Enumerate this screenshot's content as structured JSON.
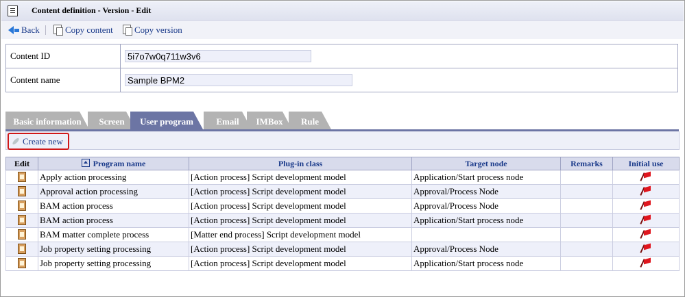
{
  "window": {
    "title": "Content definition - Version - Edit"
  },
  "toolbar": {
    "back_label": "Back",
    "copy_content_label": "Copy content",
    "copy_version_label": "Copy version"
  },
  "content": {
    "id_label": "Content ID",
    "id_value": "5i7o7w0q711w3v6",
    "name_label": "Content name",
    "name_value": "Sample BPM2"
  },
  "tabs": [
    {
      "label": "Basic information",
      "active": false
    },
    {
      "label": "Screen",
      "active": false
    },
    {
      "label": "User program",
      "active": true
    },
    {
      "label": "Email",
      "active": false
    },
    {
      "label": "IMBox",
      "active": false
    },
    {
      "label": "Rule",
      "active": false
    }
  ],
  "actions": {
    "create_new_label": "Create new",
    "highlight_color": "#d01818"
  },
  "table": {
    "headers": {
      "edit": "Edit",
      "program_name": "Program name",
      "plugin_class": "Plug-in class",
      "target_node": "Target node",
      "remarks": "Remarks",
      "initial_use": "Initial use"
    },
    "rows": [
      {
        "program_name": "Apply action processing",
        "plugin_class": "[Action process] Script development model",
        "target_node": "Application/Start process node",
        "remarks": ""
      },
      {
        "program_name": "Approval action processing",
        "plugin_class": "[Action process] Script development model",
        "target_node": "Approval/Process Node",
        "remarks": ""
      },
      {
        "program_name": "BAM action process",
        "plugin_class": "[Action process] Script development model",
        "target_node": "Approval/Process Node",
        "remarks": ""
      },
      {
        "program_name": "BAM action process",
        "plugin_class": "[Action process] Script development model",
        "target_node": "Application/Start process node",
        "remarks": ""
      },
      {
        "program_name": "BAM matter complete process",
        "plugin_class": "[Matter end process] Script development model",
        "target_node": "",
        "remarks": ""
      },
      {
        "program_name": "Job property setting processing",
        "plugin_class": "[Action process] Script development model",
        "target_node": "Approval/Process Node",
        "remarks": ""
      },
      {
        "program_name": "Job property setting processing",
        "plugin_class": "[Action process] Script development model",
        "target_node": "Application/Start process node",
        "remarks": ""
      }
    ]
  },
  "colors": {
    "tab_active": "#6c75a4",
    "tab_inactive": "#b3b3b3",
    "link": "#1a3a8a",
    "header_bg": "#d8dbec",
    "row_alt": "#eef0fa",
    "flag": "#e0161e"
  },
  "icons": {
    "title": "document-icon",
    "back": "back-arrow-icon",
    "copy": "copy-icon",
    "create": "feather-icon",
    "sort": "sort-ascending-icon",
    "edit": "edit-icon",
    "initial_use": "red-flag-icon"
  }
}
